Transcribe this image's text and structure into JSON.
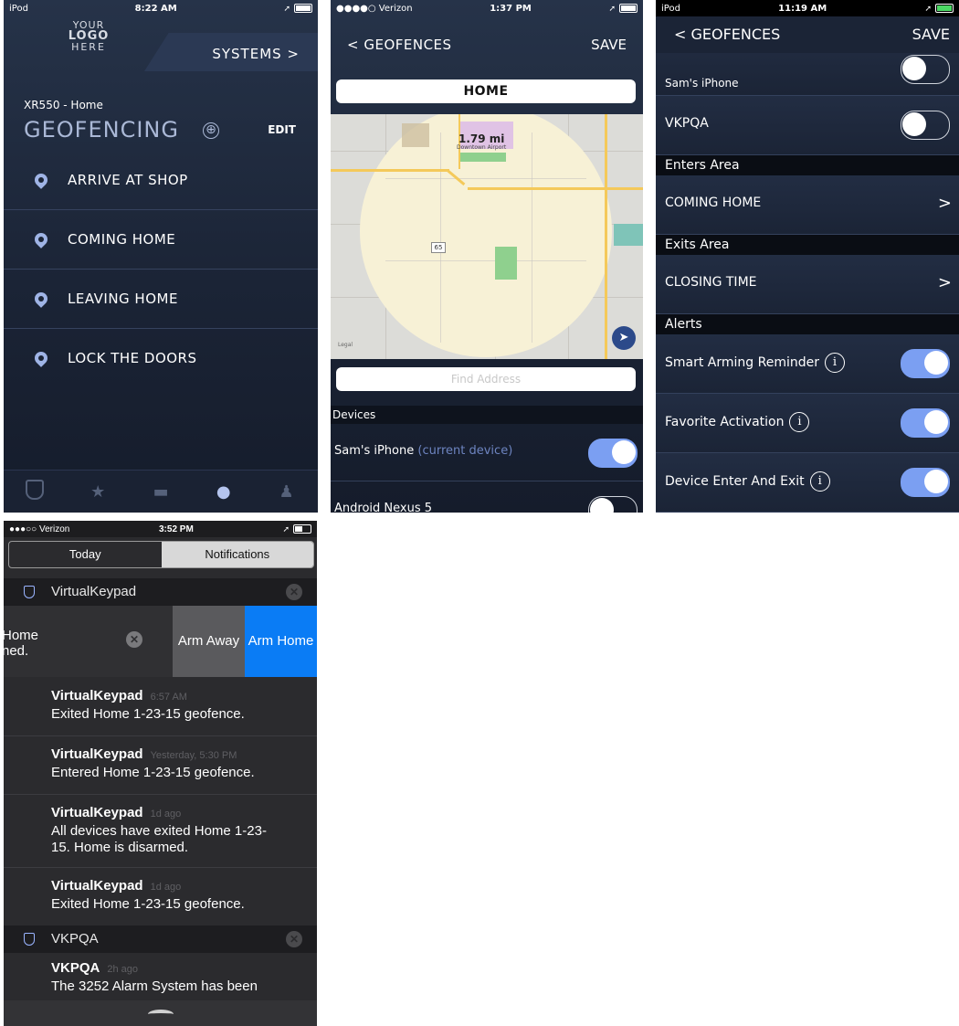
{
  "phone1": {
    "status": {
      "left": "iPod",
      "time": "8:22 AM"
    },
    "logo": {
      "line1": "YOUR",
      "line2": "LOGO",
      "line3": "HERE"
    },
    "systems_button": "SYSTEMS >",
    "system_name": "XR550 - Home",
    "title": "GEOFENCING",
    "add_icon": "⊕",
    "edit_button": "EDIT",
    "geofences": [
      {
        "label": "ARRIVE AT SHOP"
      },
      {
        "label": "COMING HOME"
      },
      {
        "label": "LEAVING HOME"
      },
      {
        "label": "LOCK THE DOORS"
      }
    ],
    "tabs": [
      "shield-icon",
      "star-icon",
      "car-icon",
      "pin-icon",
      "person-icon"
    ]
  },
  "phone2": {
    "status": {
      "left": "●●●●○ Verizon",
      "time": "1:37 PM"
    },
    "back_button": "< GEOFENCES",
    "save_button": "SAVE",
    "name_value": "HOME",
    "map": {
      "distance": "1.79 mi",
      "airport": "Downtown Airport",
      "highway": "65",
      "legal": "Legal"
    },
    "find_placeholder": "Find Address",
    "devices_header": "Devices",
    "devices": [
      {
        "name": "Sam's iPhone",
        "note": "(current device)",
        "on": true
      },
      {
        "name": "Android Nexus 5",
        "note": "",
        "on": false
      }
    ]
  },
  "phone3": {
    "status": {
      "left": "iPod",
      "time": "11:19 AM"
    },
    "back_button": "< GEOFENCES",
    "save_button": "SAVE",
    "top_device": "Sam's iPhone",
    "vkpqa": "VKPQA",
    "enters_header": "Enters Area",
    "enters_item": "COMING HOME",
    "exits_header": "Exits Area",
    "exits_item": "CLOSING TIME",
    "alerts_header": "Alerts",
    "alerts": [
      {
        "label": "Smart Arming Reminder",
        "on": true
      },
      {
        "label": "Favorite Activation",
        "on": true
      },
      {
        "label": "Device Enter And Exit",
        "on": true
      }
    ],
    "info_icon": "i",
    "chevron": ">"
  },
  "phone4": {
    "status": {
      "left": "●●●○○ Verizon",
      "time": "3:52 PM"
    },
    "tabs": [
      "Today",
      "Notifications"
    ],
    "group1": "VirtualKeypad",
    "swipe_text": "Home\nned.",
    "arm_away": "Arm Away",
    "arm_home": "Arm Home",
    "notifications": [
      {
        "app": "VirtualKeypad",
        "time": "6:57 AM",
        "body": "Exited Home 1-23-15 geofence."
      },
      {
        "app": "VirtualKeypad",
        "time": "Yesterday, 5:30 PM",
        "body": "Entered Home 1-23-15 geofence."
      },
      {
        "app": "VirtualKeypad",
        "time": "1d ago",
        "body": "All devices have exited Home 1-23-15. Home is disarmed."
      },
      {
        "app": "VirtualKeypad",
        "time": "1d ago",
        "body": "Exited Home 1-23-15 geofence."
      }
    ],
    "group2": "VKPQA",
    "vk_note": {
      "app": "VKPQA",
      "time": "2h ago",
      "body": "The 3252 Alarm System has been"
    },
    "close_icon": "✕"
  }
}
